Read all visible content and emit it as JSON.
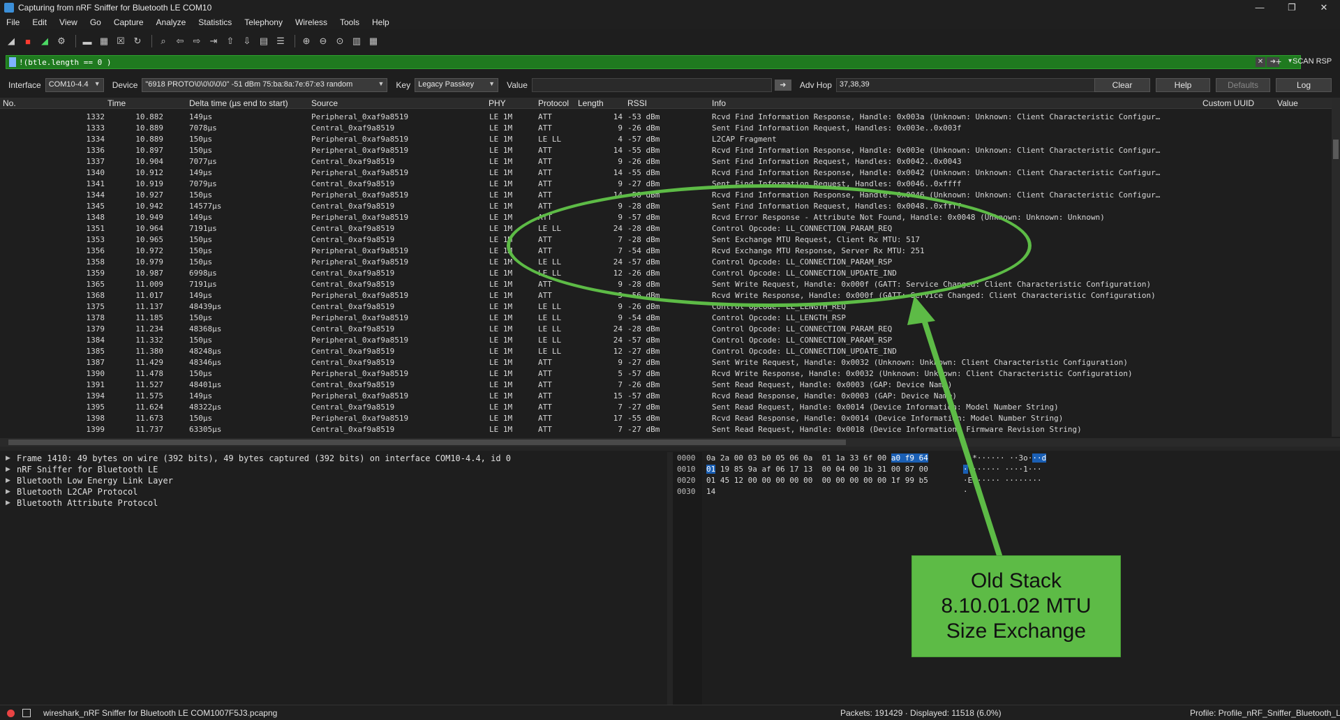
{
  "window": {
    "title": "Capturing from nRF Sniffer for Bluetooth LE COM10",
    "controls": [
      "—",
      "❐",
      "✕"
    ]
  },
  "menu": [
    "File",
    "Edit",
    "View",
    "Go",
    "Capture",
    "Analyze",
    "Statistics",
    "Telephony",
    "Wireless",
    "Tools",
    "Help"
  ],
  "toolbar_icons": [
    "shark-fin-icon",
    "stop-capture-icon",
    "restart-capture-icon",
    "capture-options-icon",
    "open-file-icon",
    "save-file-icon",
    "close-file-icon",
    "reload-file-icon",
    "find-packet-icon",
    "go-back-icon",
    "go-forward-icon",
    "go-to-packet-icon",
    "go-first-icon",
    "go-last-icon",
    "auto-scroll-icon",
    "colorize-icon",
    "zoom-in-icon",
    "zoom-out-icon",
    "zoom-normal-icon",
    "resize-columns-icon",
    "layout-icon"
  ],
  "filter": {
    "text": "!(btle.length == 0 )",
    "scan_rsp_label": "SCAN RSP"
  },
  "sniffer": {
    "interface_label": "Interface",
    "interface_value": "COM10-4.4",
    "device_label": "Device",
    "device_value": "\"6918 PROTO\\0\\0\\0\\0\\0\"  -51 dBm  75:ba:8a:7e:67:e3  random",
    "key_label": "Key",
    "key_value": "Legacy Passkey",
    "value_label": "Value",
    "advhop_label": "Adv Hop",
    "advhop_value": "37,38,39",
    "clear_label": "Clear",
    "help_label": "Help",
    "defaults_label": "Defaults",
    "log_label": "Log"
  },
  "columns": {
    "no": "No.",
    "time": "Time",
    "delta": "Delta time (µs end to start)",
    "source": "Source",
    "phy": "PHY",
    "protocol": "Protocol",
    "length": "Length",
    "rssi": "RSSI",
    "info": "Info",
    "custom_uuid": "Custom UUID",
    "value": "Value"
  },
  "packets": [
    {
      "no": "1332",
      "time": "10.882",
      "delta": "149µs",
      "source": "Peripheral_0xaf9a8519",
      "phy": "LE 1M",
      "proto": "ATT",
      "len": "14",
      "rssi": "-53 dBm",
      "info": "Rcvd Find Information Response, Handle: 0x003a (Unknown: Unknown: Client Characteristic Configur…"
    },
    {
      "no": "1333",
      "time": "10.889",
      "delta": "7078µs",
      "source": "Central_0xaf9a8519",
      "phy": "LE 1M",
      "proto": "ATT",
      "len": "9",
      "rssi": "-26 dBm",
      "info": "Sent Find Information Request, Handles: 0x003e..0x003f"
    },
    {
      "no": "1334",
      "time": "10.889",
      "delta": "150µs",
      "source": "Peripheral_0xaf9a8519",
      "phy": "LE 1M",
      "proto": "LE LL",
      "len": "4",
      "rssi": "-57 dBm",
      "info": "L2CAP Fragment"
    },
    {
      "no": "1336",
      "time": "10.897",
      "delta": "150µs",
      "source": "Peripheral_0xaf9a8519",
      "phy": "LE 1M",
      "proto": "ATT",
      "len": "14",
      "rssi": "-55 dBm",
      "info": "Rcvd Find Information Response, Handle: 0x003e (Unknown: Unknown: Client Characteristic Configur…"
    },
    {
      "no": "1337",
      "time": "10.904",
      "delta": "7077µs",
      "source": "Central_0xaf9a8519",
      "phy": "LE 1M",
      "proto": "ATT",
      "len": "9",
      "rssi": "-26 dBm",
      "info": "Sent Find Information Request, Handles: 0x0042..0x0043"
    },
    {
      "no": "1340",
      "time": "10.912",
      "delta": "149µs",
      "source": "Peripheral_0xaf9a8519",
      "phy": "LE 1M",
      "proto": "ATT",
      "len": "14",
      "rssi": "-55 dBm",
      "info": "Rcvd Find Information Response, Handle: 0x0042 (Unknown: Unknown: Client Characteristic Configur…"
    },
    {
      "no": "1341",
      "time": "10.919",
      "delta": "7079µs",
      "source": "Central_0xaf9a8519",
      "phy": "LE 1M",
      "proto": "ATT",
      "len": "9",
      "rssi": "-27 dBm",
      "info": "Sent Find Information Request, Handles: 0x0046..0xffff"
    },
    {
      "no": "1344",
      "time": "10.927",
      "delta": "150µs",
      "source": "Peripheral_0xaf9a8519",
      "phy": "LE 1M",
      "proto": "ATT",
      "len": "14",
      "rssi": "-58 dBm",
      "info": "Rcvd Find Information Response, Handle: 0x0046 (Unknown: Unknown: Client Characteristic Configur…"
    },
    {
      "no": "1345",
      "time": "10.942",
      "delta": "14577µs",
      "source": "Central_0xaf9a8519",
      "phy": "LE 1M",
      "proto": "ATT",
      "len": "9",
      "rssi": "-28 dBm",
      "info": "Sent Find Information Request, Handles: 0x0048..0xffff"
    },
    {
      "no": "1348",
      "time": "10.949",
      "delta": "149µs",
      "source": "Peripheral_0xaf9a8519",
      "phy": "LE 1M",
      "proto": "ATT",
      "len": "9",
      "rssi": "-57 dBm",
      "info": "Rcvd Error Response - Attribute Not Found, Handle: 0x0048 (Unknown: Unknown: Unknown)"
    },
    {
      "no": "1351",
      "time": "10.964",
      "delta": "7191µs",
      "source": "Central_0xaf9a8519",
      "phy": "LE 1M",
      "proto": "LE LL",
      "len": "24",
      "rssi": "-28 dBm",
      "info": "Control Opcode: LL_CONNECTION_PARAM_REQ"
    },
    {
      "no": "1353",
      "time": "10.965",
      "delta": "150µs",
      "source": "Central_0xaf9a8519",
      "phy": "LE 1M",
      "proto": "ATT",
      "len": "7",
      "rssi": "-28 dBm",
      "info": "Sent Exchange MTU Request, Client Rx MTU: 517"
    },
    {
      "no": "1356",
      "time": "10.972",
      "delta": "150µs",
      "source": "Peripheral_0xaf9a8519",
      "phy": "LE 1M",
      "proto": "ATT",
      "len": "7",
      "rssi": "-54 dBm",
      "info": "Rcvd Exchange MTU Response, Server Rx MTU: 251"
    },
    {
      "no": "1358",
      "time": "10.979",
      "delta": "150µs",
      "source": "Peripheral_0xaf9a8519",
      "phy": "LE 1M",
      "proto": "LE LL",
      "len": "24",
      "rssi": "-57 dBm",
      "info": "Control Opcode: LL_CONNECTION_PARAM_RSP"
    },
    {
      "no": "1359",
      "time": "10.987",
      "delta": "6998µs",
      "source": "Central_0xaf9a8519",
      "phy": "LE 1M",
      "proto": "LE LL",
      "len": "12",
      "rssi": "-26 dBm",
      "info": "Control Opcode: LL_CONNECTION_UPDATE_IND"
    },
    {
      "no": "1365",
      "time": "11.009",
      "delta": "7191µs",
      "source": "Central_0xaf9a8519",
      "phy": "LE 1M",
      "proto": "ATT",
      "len": "9",
      "rssi": "-28 dBm",
      "info": "Sent Write Request, Handle: 0x000f (GATT: Service Changed: Client Characteristic Configuration)"
    },
    {
      "no": "1368",
      "time": "11.017",
      "delta": "149µs",
      "source": "Peripheral_0xaf9a8519",
      "phy": "LE 1M",
      "proto": "ATT",
      "len": "5",
      "rssi": "-56 dBm",
      "info": "Rcvd Write Response, Handle: 0x000f (GATT: Service Changed: Client Characteristic Configuration)"
    },
    {
      "no": "1375",
      "time": "11.137",
      "delta": "48439µs",
      "source": "Central_0xaf9a8519",
      "phy": "LE 1M",
      "proto": "LE LL",
      "len": "9",
      "rssi": "-26 dBm",
      "info": "Control Opcode: LL_LENGTH_REQ"
    },
    {
      "no": "1378",
      "time": "11.185",
      "delta": "150µs",
      "source": "Peripheral_0xaf9a8519",
      "phy": "LE 1M",
      "proto": "LE LL",
      "len": "9",
      "rssi": "-54 dBm",
      "info": "Control Opcode: LL_LENGTH_RSP"
    },
    {
      "no": "1379",
      "time": "11.234",
      "delta": "48368µs",
      "source": "Central_0xaf9a8519",
      "phy": "LE 1M",
      "proto": "LE LL",
      "len": "24",
      "rssi": "-28 dBm",
      "info": "Control Opcode: LL_CONNECTION_PARAM_REQ"
    },
    {
      "no": "1384",
      "time": "11.332",
      "delta": "150µs",
      "source": "Peripheral_0xaf9a8519",
      "phy": "LE 1M",
      "proto": "LE LL",
      "len": "24",
      "rssi": "-57 dBm",
      "info": "Control Opcode: LL_CONNECTION_PARAM_RSP"
    },
    {
      "no": "1385",
      "time": "11.380",
      "delta": "48248µs",
      "source": "Central_0xaf9a8519",
      "phy": "LE 1M",
      "proto": "LE LL",
      "len": "12",
      "rssi": "-27 dBm",
      "info": "Control Opcode: LL_CONNECTION_UPDATE_IND"
    },
    {
      "no": "1387",
      "time": "11.429",
      "delta": "48346µs",
      "source": "Central_0xaf9a8519",
      "phy": "LE 1M",
      "proto": "ATT",
      "len": "9",
      "rssi": "-27 dBm",
      "info": "Sent Write Request, Handle: 0x0032 (Unknown: Unknown: Client Characteristic Configuration)"
    },
    {
      "no": "1390",
      "time": "11.478",
      "delta": "150µs",
      "source": "Peripheral_0xaf9a8519",
      "phy": "LE 1M",
      "proto": "ATT",
      "len": "5",
      "rssi": "-57 dBm",
      "info": "Rcvd Write Response, Handle: 0x0032 (Unknown: Unknown: Client Characteristic Configuration)"
    },
    {
      "no": "1391",
      "time": "11.527",
      "delta": "48401µs",
      "source": "Central_0xaf9a8519",
      "phy": "LE 1M",
      "proto": "ATT",
      "len": "7",
      "rssi": "-26 dBm",
      "info": "Sent Read Request, Handle: 0x0003 (GAP: Device Name)"
    },
    {
      "no": "1394",
      "time": "11.575",
      "delta": "149µs",
      "source": "Peripheral_0xaf9a8519",
      "phy": "LE 1M",
      "proto": "ATT",
      "len": "15",
      "rssi": "-57 dBm",
      "info": "Rcvd Read Response, Handle: 0x0003 (GAP: Device Name)"
    },
    {
      "no": "1395",
      "time": "11.624",
      "delta": "48322µs",
      "source": "Central_0xaf9a8519",
      "phy": "LE 1M",
      "proto": "ATT",
      "len": "7",
      "rssi": "-27 dBm",
      "info": "Sent Read Request, Handle: 0x0014 (Device Information: Model Number String)"
    },
    {
      "no": "1398",
      "time": "11.673",
      "delta": "150µs",
      "source": "Peripheral_0xaf9a8519",
      "phy": "LE 1M",
      "proto": "ATT",
      "len": "17",
      "rssi": "-55 dBm",
      "info": "Rcvd Read Response, Handle: 0x0014 (Device Information: Model Number String)"
    },
    {
      "no": "1399",
      "time": "11.737",
      "delta": "63305µs",
      "source": "Central_0xaf9a8519",
      "phy": "LE 1M",
      "proto": "ATT",
      "len": "7",
      "rssi": "-27 dBm",
      "info": "Sent Read Request, Handle: 0x0018 (Device Information: Firmware Revision String)"
    }
  ],
  "details": [
    "Frame 1410: 49 bytes on wire (392 bits), 49 bytes captured (392 bits) on interface COM10-4.4, id 0",
    "nRF Sniffer for Bluetooth LE",
    "Bluetooth Low Energy Link Layer",
    "Bluetooth L2CAP Protocol",
    "Bluetooth Attribute Protocol"
  ],
  "bytes": {
    "offsets": [
      "0000",
      "0010",
      "0020",
      "0030"
    ],
    "hex": [
      {
        "plain": "0a 2a 00 03 b0 05 06 0a  01 1a 33 6f 00 ",
        "hl": "a0 f9 64",
        "ascii_plain": " ·*······ ··3o·",
        "ascii_hl": "··d"
      },
      {
        "plain": "",
        "hl": "01",
        "rest": " 19 85 9a af 06 17 13  00 04 00 1b 31 00 87 00",
        "ascii_hl": "·",
        "ascii_rest": "······· ····1···"
      },
      {
        "plain": "01 45 12 00 00 00 00 00  00 00 00 00 00 1f 99 b5",
        "ascii_plain": "·E······ ········"
      },
      {
        "plain": "14",
        "ascii_plain": "·"
      }
    ]
  },
  "status": {
    "file": "wireshark_nRF Sniffer for Bluetooth LE COM1007F5J3.pcapng",
    "packets": "Packets: 191429 · Displayed: 11518 (6.0%)",
    "profile": "Profile: Profile_nRF_Sniffer_Bluetooth_LE"
  },
  "annotation": {
    "lines": [
      "Old Stack",
      "8.10.01.02 MTU",
      "Size Exchange"
    ],
    "color": "#5dbb46"
  }
}
